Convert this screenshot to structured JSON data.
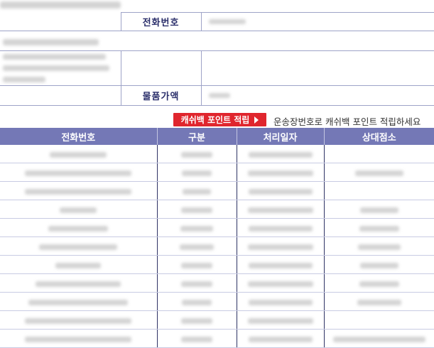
{
  "info": {
    "phone_label": "전화번호",
    "price_label": "물품가액"
  },
  "cashback": {
    "button_label": "캐쉬백 포인트 적립",
    "description": "운송장번호로 캐쉬백 포인트 적립하세요"
  },
  "history": {
    "headers": [
      "전화번호",
      "구분",
      "처리일자",
      "상대점소"
    ]
  },
  "colors": {
    "header_bg": "#7478b6",
    "button_red": "#e0262e",
    "label_text": "#2b2f6b"
  },
  "icons": {
    "cashback_arrow": "triangle-right-icon"
  }
}
